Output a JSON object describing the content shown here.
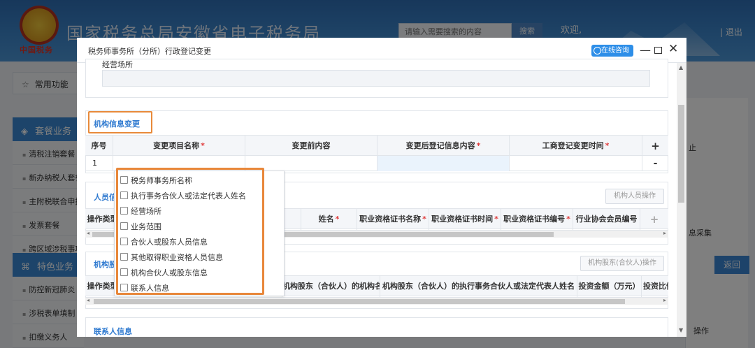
{
  "header": {
    "emblem_text": "中国税务",
    "site_title": "国家税务总局安徽省电子税务局",
    "search_placeholder": "请输入需要搜索的内容",
    "search_button": "搜索",
    "welcome": "欢迎,",
    "logout": "| 退出"
  },
  "sidebar": {
    "favorites": "常用功能",
    "package_section": "套餐业务",
    "package_items": [
      "清税注销套餐",
      "新办纳税人套餐",
      "主附税联合申报",
      "发票套餐",
      "跨区域涉税事项"
    ],
    "special_section": "特色业务",
    "special_items": [
      "防控新冠肺炎",
      "涉税表单填制",
      "扣缴义务人"
    ]
  },
  "right_panel": {
    "text1": "止",
    "text2": "息采集",
    "return_button": "返回",
    "text3": "操作"
  },
  "modal": {
    "title": "税务师事务所（分所）行政登记变更",
    "consult_button": "在线咨询",
    "business_place_label": "经营场所",
    "business_place_value": "",
    "org_change": {
      "title": "机构信息变更",
      "columns": {
        "seq": "序号",
        "item": "变更项目名称",
        "before": "变更前内容",
        "after": "变更后登记信息内容",
        "time": "工商登记变更时间",
        "add": "+"
      },
      "row": {
        "seq": "1",
        "remove": "-"
      }
    },
    "person_info": {
      "title": "人员信息",
      "action_button": "机构人员操作",
      "columns": {
        "op": "操作类型",
        "name": "姓名",
        "cert_name": "职业资格证书名称",
        "cert_time": "职业资格证书时间",
        "cert_no": "职业资格证书编号",
        "member_no": "行业协会会员编号",
        "add": "+"
      }
    },
    "shareholder_info": {
      "title": "机构股东（合伙人）信息",
      "action_button": "机构股东(合伙人)操作",
      "columns": {
        "op": "操作类型",
        "org_name": "机构股东（合伙人）的机构名称",
        "exec_partner": "机构股东（合伙人）的执行事务合伙人或法定代表人姓名",
        "amount": "投资金额（万元）",
        "ratio": "投资比例"
      }
    },
    "contact_info": {
      "title": "联系人信息"
    }
  },
  "dropdown": {
    "options": [
      "税务师事务所名称",
      "执行事务合伙人或法定代表人姓名",
      "经营场所",
      "业务范围",
      "合伙人或股东人员信息",
      "其他取得职业资格人员信息",
      "机构合伙人或股东信息",
      "联系人信息"
    ]
  },
  "colors": {
    "header_blue": "#3c86cc",
    "accent_blue": "#2f7ad0",
    "highlight_orange": "#e8873a",
    "required_red": "#e03b3b"
  }
}
